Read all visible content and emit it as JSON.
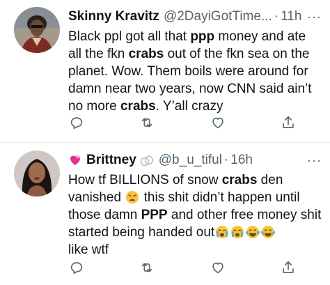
{
  "tweets": [
    {
      "name": "Skinny Kravitz",
      "handle": "@2DayiGotTime...",
      "dot": "·",
      "time": "11h",
      "more": "···",
      "body": [
        {
          "t": "Black ppl got all that "
        },
        {
          "t": "ppp",
          "b": true
        },
        {
          "t": " money and ate all the fkn "
        },
        {
          "t": "crabs",
          "b": true
        },
        {
          "t": " out of the fkn sea on the planet. Wow. Them boils were around for damn near two years, now CNN said ain’t no more "
        },
        {
          "t": "crabs",
          "b": true
        },
        {
          "t": ". Y’all crazy"
        }
      ]
    },
    {
      "name": "Brittney",
      "handle": "@b_u_tiful",
      "dot": "·",
      "time": "16h",
      "more": "···",
      "body_line1_a": "How tf BILLIONS of snow ",
      "body_line1_b": "crabs",
      "body_line1_c": " den vanished ",
      "body_line2": " this shit didn’t happen until those damn ",
      "body_ppp": "PPP",
      "body_line3": " and other free money shit started being handed out",
      "body_line4": "like wtf"
    }
  ],
  "icons": {
    "reply": "reply-icon",
    "retweet": "retweet-icon",
    "like": "like-icon",
    "share": "share-icon"
  },
  "colors": {
    "text": "#0f1419",
    "secondary": "#536471",
    "divider": "#e6ecf0"
  }
}
